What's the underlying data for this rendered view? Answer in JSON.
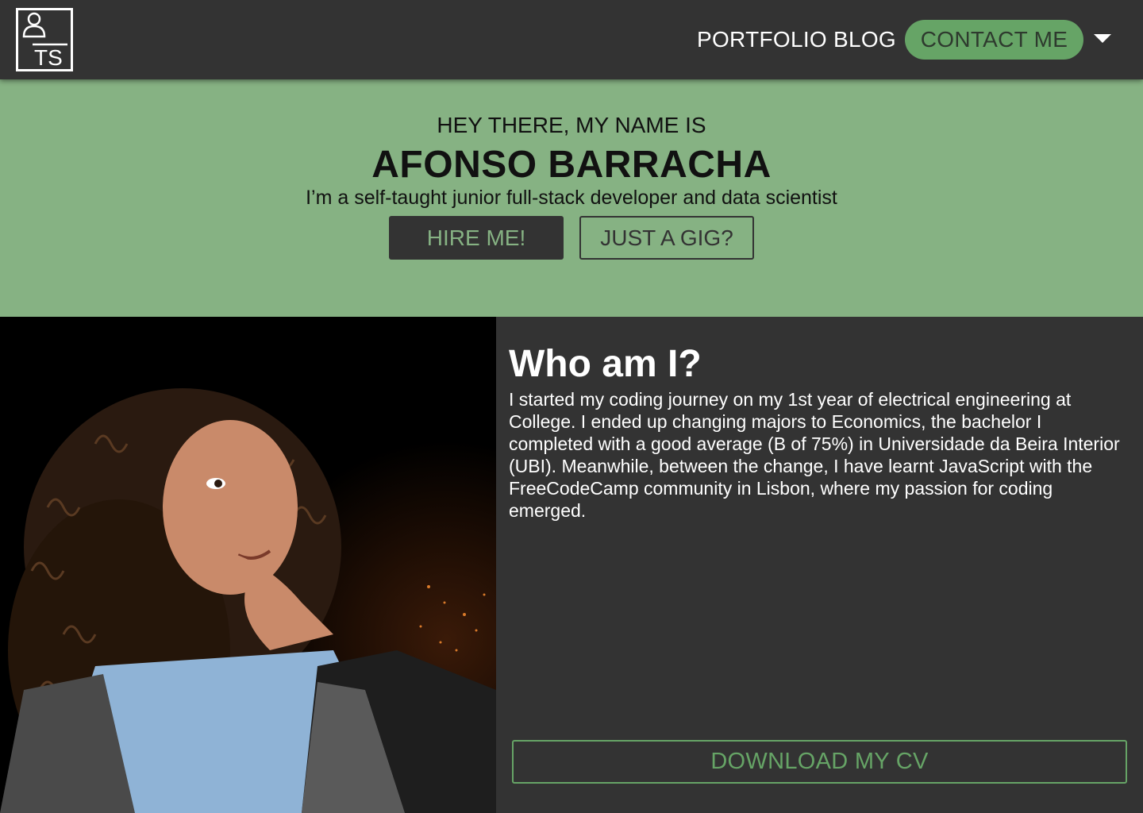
{
  "header": {
    "logo_text": "TS",
    "nav": {
      "portfolio": "PORTFOLIO",
      "blog": "BLOG",
      "contact": "CONTACT ME"
    }
  },
  "hero": {
    "kicker": "HEY THERE, MY NAME IS",
    "name": "AFONSO BARRACHA",
    "tagline": "I’m a self-taught junior full-stack developer and data scientist",
    "hire_label": "HIRE ME!",
    "gig_label": "JUST A GIG?"
  },
  "about": {
    "title": "Who am I?",
    "text": "I started my coding journey on my 1st year of electrical engineering at College. I ended up changing majors to Economics, the bachelor I completed with a good average (B of 75%) in Universidade da Beira Interior (UBI). Meanwhile, between the change, I have learnt JavaScript with the FreeCodeCamp community in Lisbon, where my passion for coding emerged.",
    "cv_label": "DOWNLOAD MY CV"
  },
  "colors": {
    "dark": "#333333",
    "green_accent": "#66a466",
    "hero_green": "#86b283"
  }
}
